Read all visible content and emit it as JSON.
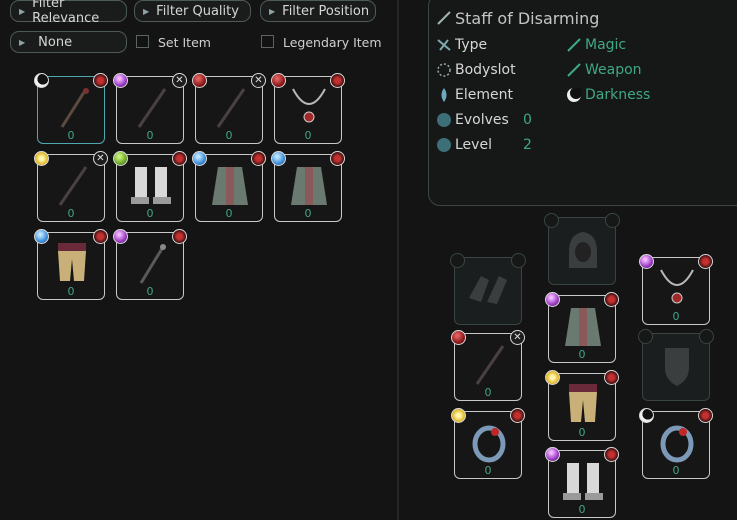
{
  "filters": {
    "relevance": "Filter Relevance",
    "quality": "Filter Quality",
    "position": "Filter Position",
    "none": "None",
    "set_item": "Set Item",
    "legendary_item": "Legendary Item"
  },
  "inventory": [
    {
      "name": "staff",
      "badge": "moon",
      "count": "0",
      "selected": true
    },
    {
      "name": "staff",
      "badge": "magic",
      "count": "0"
    },
    {
      "name": "staff",
      "badge": "red",
      "count": "0"
    },
    {
      "name": "amulet",
      "badge": "red",
      "count": "0"
    },
    {
      "name": "staff",
      "badge": "sun",
      "count": "0"
    },
    {
      "name": "boots",
      "badge": "leaf",
      "count": "0"
    },
    {
      "name": "robe",
      "badge": "water",
      "count": "0"
    },
    {
      "name": "robe",
      "badge": "water",
      "count": "0"
    },
    {
      "name": "pants",
      "badge": "water",
      "count": "0"
    },
    {
      "name": "staff",
      "badge": "magic",
      "count": "0"
    }
  ],
  "item_info": {
    "title": "Staff of Disarming",
    "type_label": "Type",
    "type_value": "Magic",
    "bodyslot_label": "Bodyslot",
    "bodyslot_value": "Weapon",
    "element_label": "Element",
    "element_value": "Darkness",
    "evolves_label": "Evolves",
    "evolves_value": "0",
    "level_label": "Level",
    "level_value": "2"
  },
  "equipment": {
    "amulet_count": "0",
    "robe_count": "0",
    "staff_count": "0",
    "pants_count": "0",
    "ring_left_count": "0",
    "ring_right_count": "0",
    "boots_count": "0"
  },
  "colors": {
    "accent": "#3fa885",
    "selected_border": "#4fa8b0"
  }
}
